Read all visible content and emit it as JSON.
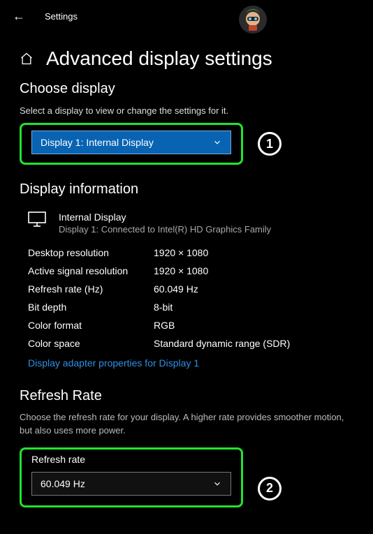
{
  "topbar": {
    "title": "Settings"
  },
  "page": {
    "title": "Advanced display settings"
  },
  "choose": {
    "heading": "Choose display",
    "desc": "Select a display to view or change the settings for it.",
    "dropdown_value": "Display 1: Internal Display"
  },
  "info": {
    "heading": "Display information",
    "monitor_name": "Internal Display",
    "monitor_sub": "Display 1: Connected to Intel(R) HD Graphics Family",
    "rows": {
      "desktop_res_k": "Desktop resolution",
      "desktop_res_v": "1920 × 1080",
      "active_res_k": "Active signal resolution",
      "active_res_v": "1920 × 1080",
      "refresh_k": "Refresh rate (Hz)",
      "refresh_v": "60.049 Hz",
      "bitdepth_k": "Bit depth",
      "bitdepth_v": "8-bit",
      "colorfmt_k": "Color format",
      "colorfmt_v": "RGB",
      "colorspace_k": "Color space",
      "colorspace_v": "Standard dynamic range (SDR)"
    },
    "link": "Display adapter properties for Display 1"
  },
  "refresh": {
    "heading": "Refresh Rate",
    "desc": "Choose the refresh rate for your display. A higher rate provides smoother motion, but also uses more power.",
    "label": "Refresh rate",
    "dropdown_value": "60.049 Hz"
  },
  "steps": {
    "one": "1",
    "two": "2"
  }
}
